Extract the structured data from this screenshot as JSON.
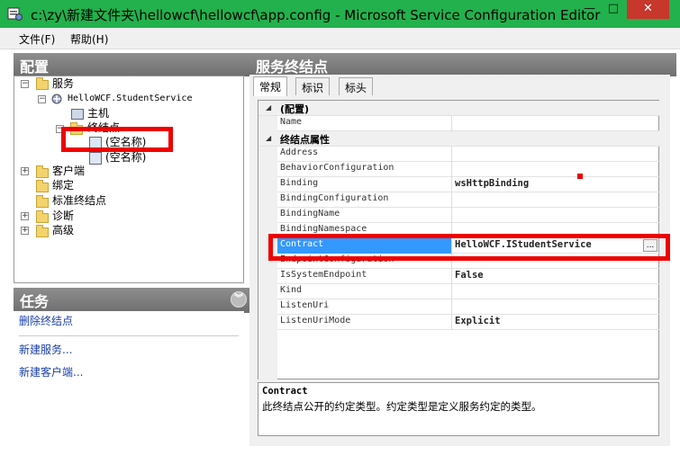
{
  "window": {
    "title": "c:\\zy\\新建文件夹\\hellowcf\\hellowcf\\app.config - Microsoft Service Configuration Editor",
    "minimize": "—",
    "maximize": "□",
    "close": "✕"
  },
  "menu": {
    "file": "文件(F)",
    "help": "帮助(H)"
  },
  "config_panel": {
    "title": "配置",
    "tree": {
      "services": "服务",
      "service_name": "HelloWCF.StudentService",
      "host": "主机",
      "endpoints": "终结点",
      "endpoint_1": "(空名称)",
      "endpoint_2": "(空名称)",
      "client": "客户端",
      "bindings": "绑定",
      "standard_endpoints": "标准终结点",
      "diagnostics": "诊断",
      "advanced": "高级"
    }
  },
  "tasks_panel": {
    "title": "任务",
    "items": [
      "删除终结点",
      "新建服务...",
      "新建客户端..."
    ]
  },
  "endpoint_panel": {
    "title": "服务终结点",
    "tabs": [
      "常规",
      "标识",
      "标头"
    ],
    "category_config": "(配置)",
    "category_props": "终结点属性",
    "rows": [
      {
        "name": "Name",
        "value": ""
      },
      {
        "name": "Address",
        "value": ""
      },
      {
        "name": "BehaviorConfiguration",
        "value": ""
      },
      {
        "name": "Binding",
        "value": "wsHttpBinding"
      },
      {
        "name": "BindingConfiguration",
        "value": ""
      },
      {
        "name": "BindingName",
        "value": ""
      },
      {
        "name": "BindingNamespace",
        "value": ""
      },
      {
        "name": "Contract",
        "value": "HelloWCF.IStudentService"
      },
      {
        "name": "EndpointConfiguration",
        "value": ""
      },
      {
        "name": "IsSystemEndpoint",
        "value": "False"
      },
      {
        "name": "Kind",
        "value": ""
      },
      {
        "name": "ListenUri",
        "value": ""
      },
      {
        "name": "ListenUriMode",
        "value": "Explicit"
      }
    ],
    "ellipsis": "...",
    "description": {
      "title": "Contract",
      "text": "此终结点公开的约定类型。约定类型是定义服务约定的类型。"
    }
  },
  "colors": {
    "title_bar": "#22b14c",
    "highlight": "#3399ff",
    "annotation": "#ee0000"
  }
}
